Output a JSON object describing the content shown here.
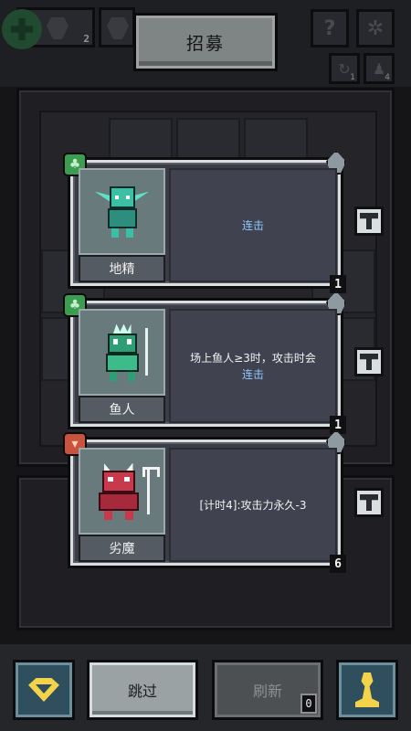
{
  "header": {
    "recruit_label": "招募",
    "slot1_count": "2",
    "slot2_count": "",
    "counter_a": "1",
    "counter_b": "4"
  },
  "offers": [
    {
      "name": "地精",
      "tribe": "clover",
      "desc_line1": "",
      "desc_keyword": "连击",
      "tier": "1",
      "creature_icon": "goblin-icon",
      "colors": {
        "primary": "#3cbfa6"
      }
    },
    {
      "name": "鱼人",
      "tribe": "clover",
      "desc_line1": "场上鱼人≥3时，攻击时会",
      "desc_keyword": "连击",
      "tier": "1",
      "creature_icon": "murloc-icon",
      "colors": {
        "primary": "#3dbb8b"
      }
    },
    {
      "name": "劣魔",
      "tribe": "fox",
      "desc_line1": "[计时4]:攻击力永久-3",
      "desc_keyword": "",
      "tier": "6",
      "creature_icon": "imp-icon",
      "colors": {
        "primary": "#c7394b"
      }
    }
  ],
  "footer": {
    "skip_label": "跳过",
    "refresh_label": "刷新",
    "refresh_cost": "0"
  },
  "colors": {
    "keyword": "#8ec9ff",
    "gold": "#f2d34a",
    "background": "#1c1d20"
  }
}
